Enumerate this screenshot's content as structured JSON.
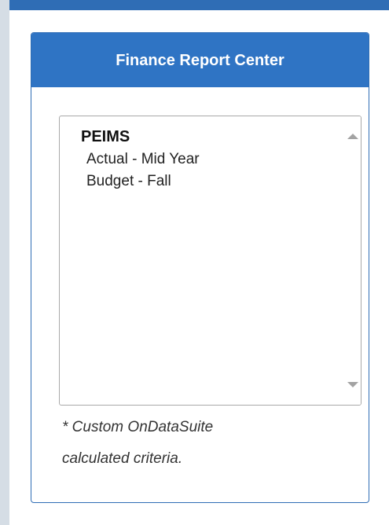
{
  "panel": {
    "title": "Finance Report Center"
  },
  "report_list": {
    "group_label": "PEIMS",
    "options": [
      {
        "label": "Actual - Mid Year"
      },
      {
        "label": "Budget - Fall"
      }
    ]
  },
  "footnote": {
    "line1": "* Custom OnDataSuite",
    "line2": "calculated criteria."
  },
  "colors": {
    "accent": "#2f74c4",
    "sidebar": "#d5dde5"
  },
  "icons": {
    "scroll_up": "scroll-up-arrow-icon",
    "scroll_down": "scroll-down-arrow-icon"
  }
}
